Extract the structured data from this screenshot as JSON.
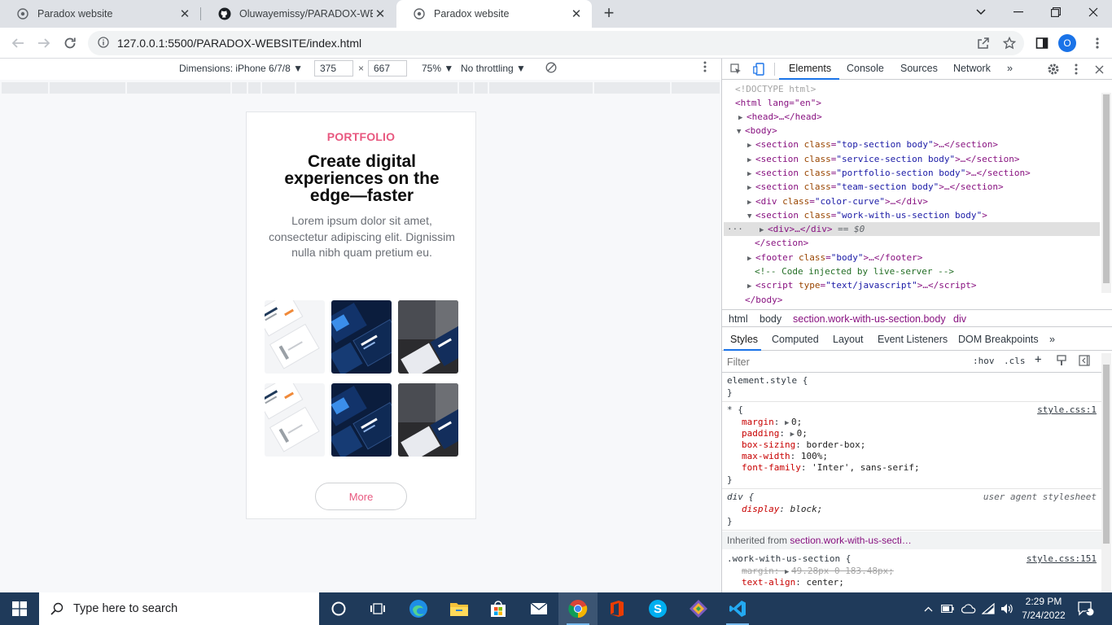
{
  "browser": {
    "tabs": [
      {
        "title": "Paradox website",
        "icon": "chrome-page-icon",
        "active": false
      },
      {
        "title": "Oluwayemissy/PARADOX-WEBSITE",
        "icon": "github-icon",
        "active": false
      },
      {
        "title": "Paradox website",
        "icon": "chrome-page-icon",
        "active": true
      }
    ],
    "new_tab": "+",
    "url": "127.0.0.1:5500/PARADOX-WEBSITE/index.html",
    "profile_initial": "O"
  },
  "device_toolbar": {
    "dimensions_label": "Dimensions: iPhone 6/7/8 ▼",
    "width": "375",
    "height": "667",
    "times": "×",
    "zoom": "75% ▼",
    "throttling": "No throttling ▼"
  },
  "page": {
    "eyebrow": "PORTFOLIO",
    "headline": "Create digital experiences on the edge—faster",
    "lead": "Lorem ipsum dolor sit amet, consectetur adipiscing elit. Dignissim nulla nibh quam pretium eu.",
    "more_button": "More"
  },
  "devtools": {
    "tabs": [
      "Elements",
      "Console",
      "Sources",
      "Network",
      "»"
    ],
    "dom": {
      "doctype": "<!DOCTYPE html>",
      "html_open": "<html lang=\"en\">",
      "head": "<head>…</head>",
      "body_open": "<body>",
      "sections": [
        "top-section body",
        "service-section body",
        "portfolio-section body",
        "team-section body"
      ],
      "color_curve": "color-curve",
      "work_section": "work-with-us-section body",
      "selected_div": "<div>…</div>",
      "selected_suffix": "== $0",
      "section_close": "</section>",
      "footer_class": "body",
      "comment": "<!-- Code injected by live-server -->",
      "script_type": "text/javascript",
      "body_close": "</body>"
    },
    "breadcrumbs": [
      "html",
      "body",
      "section.work-with-us-section.body",
      "div"
    ],
    "style_tabs": [
      "Styles",
      "Computed",
      "Layout",
      "Event Listeners",
      "DOM Breakpoints",
      "»"
    ],
    "filter_placeholder": "Filter",
    "hov": ":hov",
    "cls": ".cls",
    "rules": {
      "element_style": "element.style {",
      "universal_selector": "* {",
      "universal_source": "style.css:1",
      "universal_props": [
        {
          "name": "margin",
          "value": "0;"
        },
        {
          "name": "padding",
          "value": "0;"
        },
        {
          "name": "box-sizing",
          "value": "border-box;"
        },
        {
          "name": "max-width",
          "value": "100%;"
        },
        {
          "name": "font-family",
          "value": "'Inter', sans-serif;"
        }
      ],
      "div_selector": "div {",
      "div_source": "user agent stylesheet",
      "div_prop": {
        "name": "display",
        "value": "block;"
      },
      "inherited_label": "Inherited from",
      "inherited_from": "section.work-with-us-secti…",
      "work_selector": ".work-with-us-section {",
      "work_source": "style.css:151",
      "work_props": [
        {
          "name": "margin",
          "value": "49.28px 0 183.48px;"
        },
        {
          "name": "text-align",
          "value": "center;"
        }
      ],
      "close_brace": "}"
    }
  },
  "taskbar": {
    "search_placeholder": "Type here to search",
    "time": "2:29 PM",
    "date": "7/24/2022",
    "notification_count": "1"
  }
}
